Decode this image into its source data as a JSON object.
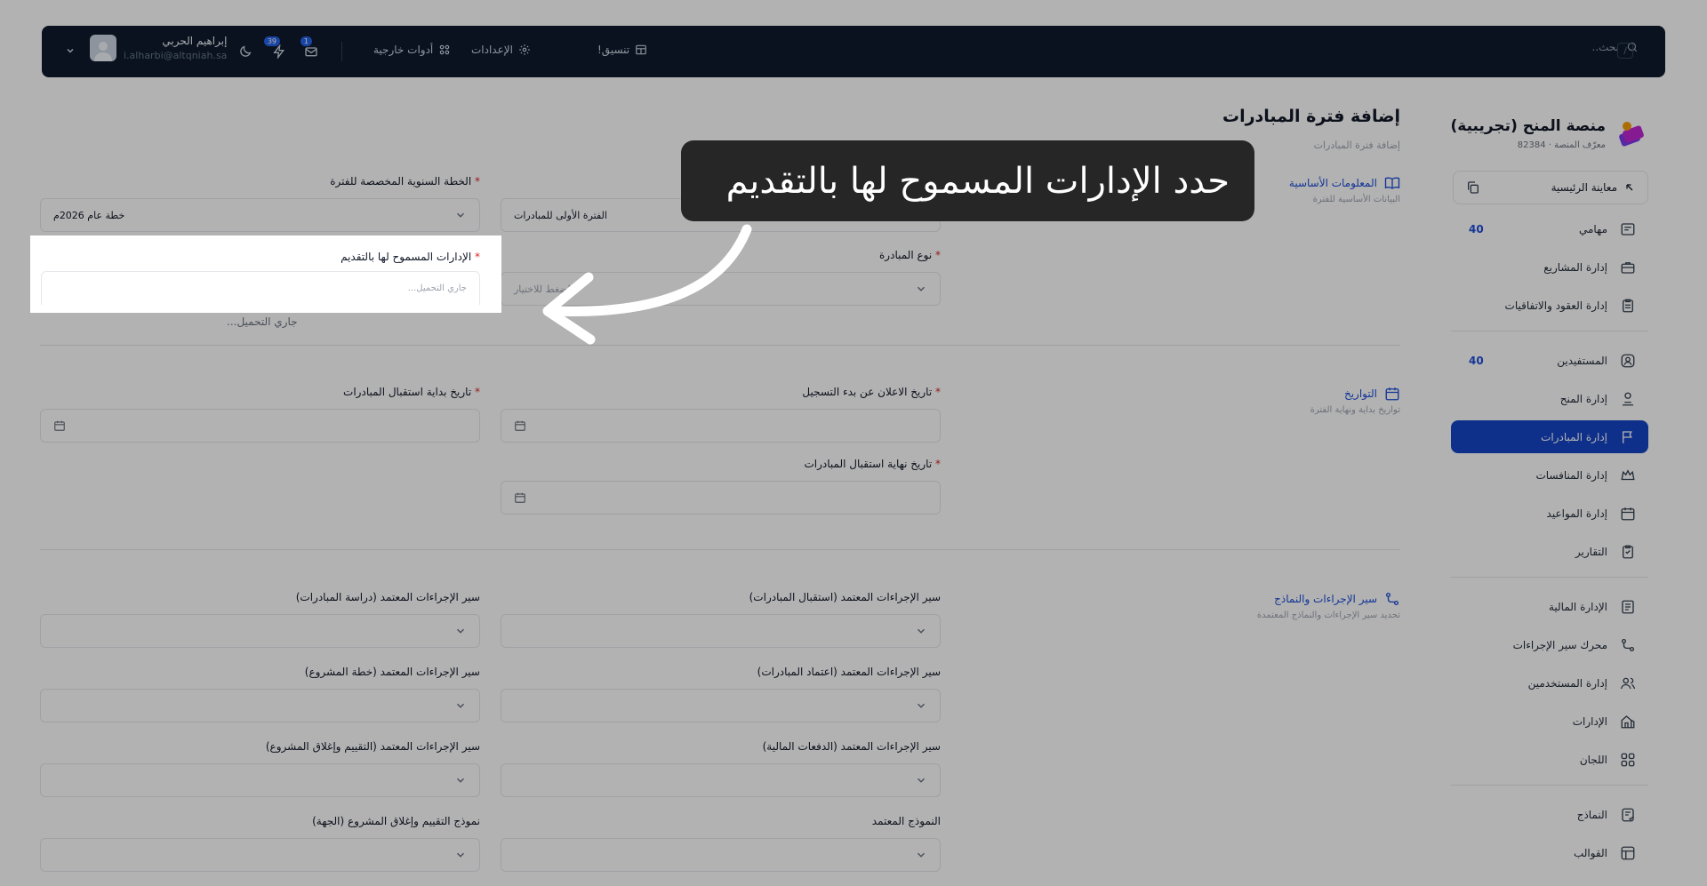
{
  "topbar": {
    "search_placeholder": "بحث..",
    "search_shortcut": "/",
    "menu_coordinate": "تنسيق!",
    "menu_settings": "الإعدادات",
    "menu_tools": "أدوات خارجية",
    "user_name": "إبراهيم الحربي",
    "user_email": "i.alharbi@altqniah.sa",
    "notif_count": "39",
    "mail_count": "1"
  },
  "sidebar": {
    "brand_title": "منصة المنح (تجريبية)",
    "brand_sub": "معرّف المنصة · 82384",
    "preview_label": "معاينة الرئيسية",
    "items": [
      {
        "label": "مهامي",
        "icon": "tasks-icon",
        "count": "40"
      },
      {
        "label": "إدارة المشاريع",
        "icon": "briefcase-icon"
      },
      {
        "label": "إدارة العقود والاتفاقيات",
        "icon": "clipboard-icon"
      },
      {
        "label": "المستفيدين",
        "icon": "user-circle-icon",
        "count": "40"
      },
      {
        "label": "إدارة المنح",
        "icon": "grant-user-icon"
      },
      {
        "label": "إدارة المبادرات",
        "icon": "flag-icon",
        "active": true
      },
      {
        "label": "إدارة المنافسات",
        "icon": "crown-icon"
      },
      {
        "label": "إدارة المواعيد",
        "icon": "calendar-icon"
      },
      {
        "label": "التقارير",
        "icon": "report-icon"
      },
      {
        "label": "الإدارة المالية",
        "icon": "finance-icon"
      },
      {
        "label": "محرك سير الإجراءات",
        "icon": "workflow-icon"
      },
      {
        "label": "إدارة المستخدمين",
        "icon": "users-icon"
      },
      {
        "label": "الإدارات",
        "icon": "building-icon"
      },
      {
        "label": "اللجان",
        "icon": "grid-icon"
      },
      {
        "label": "النماذج",
        "icon": "form-icon"
      },
      {
        "label": "القوالب",
        "icon": "template-icon"
      }
    ]
  },
  "main": {
    "title": "إضافة فترة المبادرات",
    "breadcrumb": "إضافة فترة المبادرات",
    "sections": {
      "basic": {
        "title": "المعلومات الأساسية",
        "desc": "البيانات الأساسية للفترة"
      },
      "dates": {
        "title": "التواريخ",
        "desc": "تواريخ بداية ونهاية الفترة"
      },
      "workflow": {
        "title": "سير الإجراءات والنماذج",
        "desc": "تحديد سير الإجراءات والنماذج المعتمدة"
      }
    },
    "fields": {
      "annual_plan": {
        "label": "الخطة السنوية المخصصة للفترة",
        "value": "خطة عام 2026م"
      },
      "period_name": {
        "value": "الفترة الأولى للمبادرات"
      },
      "initiative_type": {
        "label": "نوع المبادرة",
        "placeholder": "اضغط للاختيار"
      },
      "departments": {
        "label": "الإدارات المسموح لها بالتقديم",
        "placeholder": "جاري التحميل..."
      },
      "departments_loading": "جاري التحميل...",
      "announce_date": {
        "label": "تاريخ الاعلان عن بدء التسجيل"
      },
      "receive_start": {
        "label": "تاريخ بداية استقبال المبادرات"
      },
      "receive_end": {
        "label": "تاريخ نهاية استقبال المبادرات"
      },
      "wf_receive": {
        "label": "سير الإجراءات المعتمد (استقبال المبادرات)"
      },
      "wf_study": {
        "label": "سير الإجراءات المعتمد (دراسة المبادرات)"
      },
      "wf_approve": {
        "label": "سير الإجراءات المعتمد (اعتماد المبادرات)"
      },
      "wf_plan": {
        "label": "سير الإجراءات المعتمد (خطة المشروع)"
      },
      "wf_payments": {
        "label": "سير الإجراءات المعتمد (الدفعات المالية)"
      },
      "wf_close": {
        "label": "سير الإجراءات المعتمد (التقييم وإغلاق المشروع)"
      },
      "approved_form": {
        "label": "النموذج المعتمد"
      },
      "close_form": {
        "label": "نموذج التقييم وإغلاق المشروع (الجهة)"
      }
    }
  },
  "overlay": {
    "tooltip": "حدد الإدارات المسموح لها بالتقديم",
    "dim_color": "#000000",
    "accent": "#1546c7"
  }
}
